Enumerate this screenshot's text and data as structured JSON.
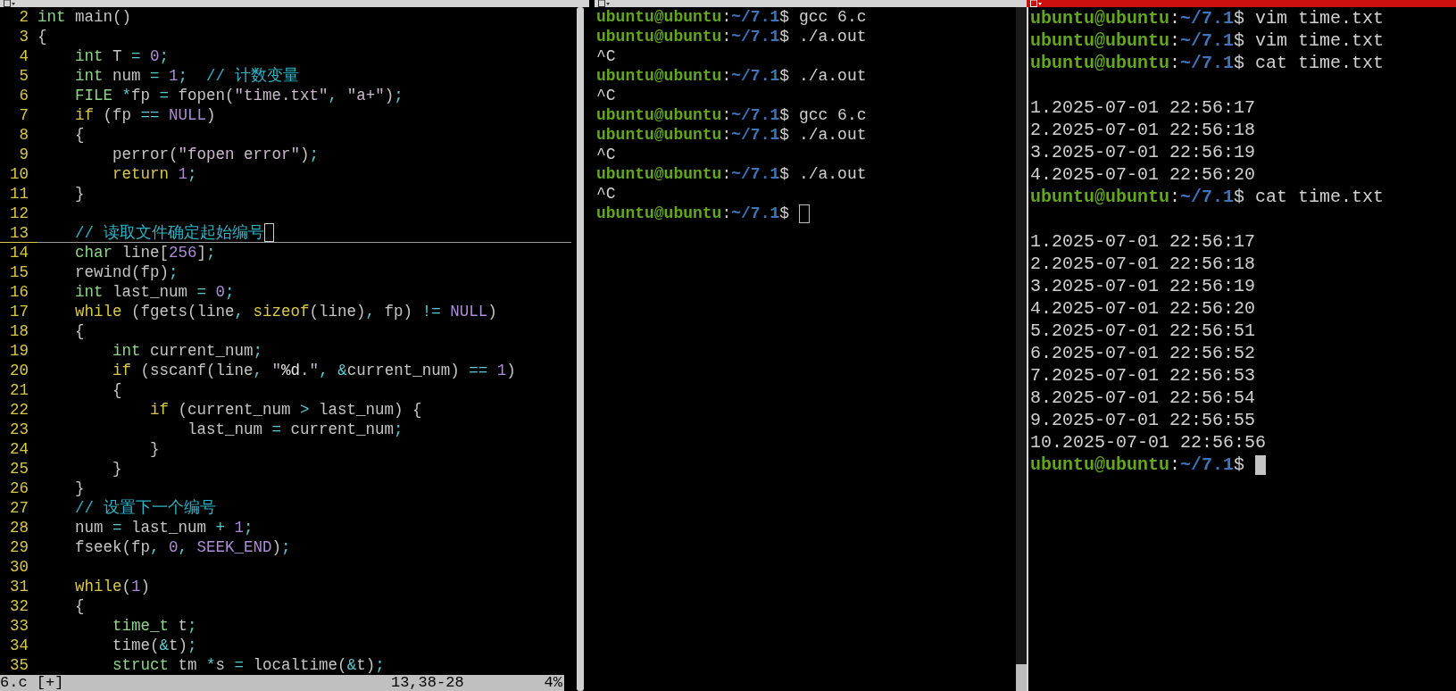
{
  "panes": [
    {
      "kind": "vim",
      "active": false,
      "lines": [
        {
          "number": "2",
          "segments": [
            {
              "kind": "type",
              "text": "int"
            },
            {
              "kind": "plain",
              "text": " main()"
            }
          ]
        },
        {
          "number": "3",
          "segments": [
            {
              "kind": "plain",
              "text": "{"
            }
          ]
        },
        {
          "number": "4",
          "segments": [
            {
              "kind": "type",
              "text": "    int"
            },
            {
              "kind": "plain",
              "text": " T "
            },
            {
              "kind": "op",
              "text": "="
            },
            {
              "kind": "num",
              "text": " 0"
            },
            {
              "kind": "op",
              "text": ";"
            }
          ]
        },
        {
          "number": "5",
          "segments": [
            {
              "kind": "type",
              "text": "    int"
            },
            {
              "kind": "plain",
              "text": " num "
            },
            {
              "kind": "op",
              "text": "="
            },
            {
              "kind": "num",
              "text": " 1"
            },
            {
              "kind": "op",
              "text": ";"
            },
            {
              "kind": "comment",
              "text": "  // 计数变量"
            }
          ]
        },
        {
          "number": "6",
          "segments": [
            {
              "kind": "type",
              "text": "    FILE"
            },
            {
              "kind": "op",
              "text": " *"
            },
            {
              "kind": "plain",
              "text": "fp "
            },
            {
              "kind": "op",
              "text": "="
            },
            {
              "kind": "plain",
              "text": " fopen("
            },
            {
              "kind": "str",
              "text": "\"time.txt\""
            },
            {
              "kind": "op",
              "text": ","
            },
            {
              "kind": "str",
              "text": " \"a+\""
            },
            {
              "kind": "plain",
              "text": ")"
            },
            {
              "kind": "op",
              "text": ";"
            }
          ]
        },
        {
          "number": "7",
          "segments": [
            {
              "kind": "kw",
              "text": "    if"
            },
            {
              "kind": "plain",
              "text": " (fp "
            },
            {
              "kind": "op",
              "text": "=="
            },
            {
              "kind": "num",
              "text": " NULL"
            },
            {
              "kind": "plain",
              "text": ")"
            }
          ]
        },
        {
          "number": "8",
          "segments": [
            {
              "kind": "plain",
              "text": "    {"
            }
          ]
        },
        {
          "number": "9",
          "segments": [
            {
              "kind": "plain",
              "text": "        perror("
            },
            {
              "kind": "str",
              "text": "\"fopen error\""
            },
            {
              "kind": "plain",
              "text": ")"
            },
            {
              "kind": "op",
              "text": ";"
            }
          ]
        },
        {
          "number": "10",
          "segments": [
            {
              "kind": "kw",
              "text": "        return"
            },
            {
              "kind": "num",
              "text": " 1"
            },
            {
              "kind": "op",
              "text": ";"
            }
          ]
        },
        {
          "number": "11",
          "segments": [
            {
              "kind": "plain",
              "text": "    }"
            }
          ]
        },
        {
          "number": "12"
        },
        {
          "number": "13",
          "cursor_line": true,
          "cursor": true,
          "segments": [
            {
              "kind": "comment",
              "text": "    // 读取文件确定起始编号"
            }
          ]
        },
        {
          "number": "14",
          "segments": [
            {
              "kind": "type",
              "text": "    char"
            },
            {
              "kind": "plain",
              "text": " line["
            },
            {
              "kind": "num",
              "text": "256"
            },
            {
              "kind": "plain",
              "text": "]"
            },
            {
              "kind": "op",
              "text": ";"
            }
          ]
        },
        {
          "number": "15",
          "segments": [
            {
              "kind": "plain",
              "text": "    rewind(fp)"
            },
            {
              "kind": "op",
              "text": ";"
            }
          ]
        },
        {
          "number": "16",
          "segments": [
            {
              "kind": "type",
              "text": "    int"
            },
            {
              "kind": "plain",
              "text": " last_num "
            },
            {
              "kind": "op",
              "text": "="
            },
            {
              "kind": "num",
              "text": " 0"
            },
            {
              "kind": "op",
              "text": ";"
            }
          ]
        },
        {
          "number": "17",
          "segments": [
            {
              "kind": "kw",
              "text": "    while"
            },
            {
              "kind": "plain",
              "text": " (fgets(line"
            },
            {
              "kind": "op",
              "text": ","
            },
            {
              "kind": "kw",
              "text": " sizeof"
            },
            {
              "kind": "plain",
              "text": "(line)"
            },
            {
              "kind": "op",
              "text": ","
            },
            {
              "kind": "plain",
              "text": " fp) "
            },
            {
              "kind": "op",
              "text": "!="
            },
            {
              "kind": "num",
              "text": " NULL"
            },
            {
              "kind": "plain",
              "text": ")"
            }
          ]
        },
        {
          "number": "18",
          "segments": [
            {
              "kind": "plain",
              "text": "    {"
            }
          ]
        },
        {
          "number": "19",
          "segments": [
            {
              "kind": "type",
              "text": "        int"
            },
            {
              "kind": "plain",
              "text": " current_num"
            },
            {
              "kind": "op",
              "text": ";"
            }
          ]
        },
        {
          "number": "20",
          "segments": [
            {
              "kind": "kw",
              "text": "        if"
            },
            {
              "kind": "plain",
              "text": " (sscanf(line"
            },
            {
              "kind": "op",
              "text": ","
            },
            {
              "kind": "str",
              "text": " \""
            },
            {
              "kind": "fmt",
              "text": "%d"
            },
            {
              "kind": "str",
              "text": ".\""
            },
            {
              "kind": "op",
              "text": ","
            },
            {
              "kind": "op",
              "text": " &"
            },
            {
              "kind": "plain",
              "text": "current_num) "
            },
            {
              "kind": "op",
              "text": "=="
            },
            {
              "kind": "num",
              "text": " 1"
            },
            {
              "kind": "plain",
              "text": ")"
            }
          ]
        },
        {
          "number": "21",
          "segments": [
            {
              "kind": "plain",
              "text": "        {"
            }
          ]
        },
        {
          "number": "22",
          "segments": [
            {
              "kind": "kw",
              "text": "            if"
            },
            {
              "kind": "plain",
              "text": " (current_num "
            },
            {
              "kind": "op",
              "text": ">"
            },
            {
              "kind": "plain",
              "text": " last_num) {"
            }
          ]
        },
        {
          "number": "23",
          "segments": [
            {
              "kind": "plain",
              "text": "                last_num "
            },
            {
              "kind": "op",
              "text": "="
            },
            {
              "kind": "plain",
              "text": " current_num"
            },
            {
              "kind": "op",
              "text": ";"
            }
          ]
        },
        {
          "number": "24",
          "segments": [
            {
              "kind": "plain",
              "text": "            }"
            }
          ]
        },
        {
          "number": "25",
          "segments": [
            {
              "kind": "plain",
              "text": "        }"
            }
          ]
        },
        {
          "number": "26",
          "segments": [
            {
              "kind": "plain",
              "text": "    }"
            }
          ]
        },
        {
          "number": "27",
          "segments": [
            {
              "kind": "comment",
              "text": "    // 设置下一个编号"
            }
          ]
        },
        {
          "number": "28",
          "segments": [
            {
              "kind": "plain",
              "text": "    num "
            },
            {
              "kind": "op",
              "text": "="
            },
            {
              "kind": "plain",
              "text": " last_num "
            },
            {
              "kind": "op",
              "text": "+"
            },
            {
              "kind": "num",
              "text": " 1"
            },
            {
              "kind": "op",
              "text": ";"
            }
          ]
        },
        {
          "number": "29",
          "segments": [
            {
              "kind": "plain",
              "text": "    fseek(fp"
            },
            {
              "kind": "op",
              "text": ","
            },
            {
              "kind": "num",
              "text": " 0"
            },
            {
              "kind": "op",
              "text": ","
            },
            {
              "kind": "num",
              "text": " SEEK_END"
            },
            {
              "kind": "plain",
              "text": ")"
            },
            {
              "kind": "op",
              "text": ";"
            }
          ]
        },
        {
          "number": "30"
        },
        {
          "number": "31",
          "segments": [
            {
              "kind": "kw",
              "text": "    while"
            },
            {
              "kind": "plain",
              "text": "("
            },
            {
              "kind": "num",
              "text": "1"
            },
            {
              "kind": "plain",
              "text": ")"
            }
          ]
        },
        {
          "number": "32",
          "segments": [
            {
              "kind": "plain",
              "text": "    {"
            }
          ]
        },
        {
          "number": "33",
          "segments": [
            {
              "kind": "type",
              "text": "        time_t"
            },
            {
              "kind": "plain",
              "text": " t"
            },
            {
              "kind": "op",
              "text": ";"
            }
          ]
        },
        {
          "number": "34",
          "segments": [
            {
              "kind": "plain",
              "text": "        time("
            },
            {
              "kind": "op",
              "text": "&"
            },
            {
              "kind": "plain",
              "text": "t)"
            },
            {
              "kind": "op",
              "text": ";"
            }
          ]
        },
        {
          "number": "35",
          "segments": [
            {
              "kind": "type",
              "text": "        struct"
            },
            {
              "kind": "plain",
              "text": " tm "
            },
            {
              "kind": "op",
              "text": "*"
            },
            {
              "kind": "plain",
              "text": "s "
            },
            {
              "kind": "op",
              "text": "="
            },
            {
              "kind": "plain",
              "text": " localtime("
            },
            {
              "kind": "op",
              "text": "&"
            },
            {
              "kind": "plain",
              "text": "t)"
            },
            {
              "kind": "op",
              "text": ";"
            }
          ]
        }
      ],
      "status": {
        "file": "6.c [+]",
        "position": "13,38-28",
        "percent": "4%"
      }
    },
    {
      "kind": "terminal",
      "active": false,
      "lines": [
        {
          "kind": "prompt",
          "user": "ubuntu@ubuntu",
          "sep": ":",
          "path": "~/7.1",
          "sigil": "$",
          "command": "gcc 6.c"
        },
        {
          "kind": "prompt",
          "user": "ubuntu@ubuntu",
          "sep": ":",
          "path": "~/7.1",
          "sigil": "$",
          "command": "./a.out"
        },
        {
          "kind": "output",
          "text": "^C"
        },
        {
          "kind": "prompt",
          "user": "ubuntu@ubuntu",
          "sep": ":",
          "path": "~/7.1",
          "sigil": "$",
          "command": "./a.out"
        },
        {
          "kind": "output",
          "text": "^C"
        },
        {
          "kind": "prompt",
          "user": "ubuntu@ubuntu",
          "sep": ":",
          "path": "~/7.1",
          "sigil": "$",
          "command": "gcc 6.c"
        },
        {
          "kind": "prompt",
          "user": "ubuntu@ubuntu",
          "sep": ":",
          "path": "~/7.1",
          "sigil": "$",
          "command": "./a.out"
        },
        {
          "kind": "output",
          "text": "^C"
        },
        {
          "kind": "prompt",
          "user": "ubuntu@ubuntu",
          "sep": ":",
          "path": "~/7.1",
          "sigil": "$",
          "command": "./a.out"
        },
        {
          "kind": "output",
          "text": "^C"
        },
        {
          "kind": "prompt",
          "user": "ubuntu@ubuntu",
          "sep": ":",
          "path": "~/7.1",
          "sigil": "$",
          "cursor": true,
          "cursor_filled": false
        }
      ]
    },
    {
      "kind": "terminal",
      "active": true,
      "lines": [
        {
          "kind": "prompt",
          "user": "ubuntu@ubuntu",
          "sep": ":",
          "path": "~/7.1",
          "sigil": "$",
          "command": "vim time.txt"
        },
        {
          "kind": "prompt",
          "user": "ubuntu@ubuntu",
          "sep": ":",
          "path": "~/7.1",
          "sigil": "$",
          "command": "vim time.txt"
        },
        {
          "kind": "prompt",
          "user": "ubuntu@ubuntu",
          "sep": ":",
          "path": "~/7.1",
          "sigil": "$",
          "command": "cat time.txt"
        },
        {
          "kind": "blank"
        },
        {
          "kind": "output",
          "text": "1.2025-07-01 22:56:17"
        },
        {
          "kind": "output",
          "text": "2.2025-07-01 22:56:18"
        },
        {
          "kind": "output",
          "text": "3.2025-07-01 22:56:19"
        },
        {
          "kind": "output",
          "text": "4.2025-07-01 22:56:20"
        },
        {
          "kind": "prompt",
          "user": "ubuntu@ubuntu",
          "sep": ":",
          "path": "~/7.1",
          "sigil": "$",
          "command": "cat time.txt"
        },
        {
          "kind": "blank"
        },
        {
          "kind": "output",
          "text": "1.2025-07-01 22:56:17"
        },
        {
          "kind": "output",
          "text": "2.2025-07-01 22:56:18"
        },
        {
          "kind": "output",
          "text": "3.2025-07-01 22:56:19"
        },
        {
          "kind": "output",
          "text": "4.2025-07-01 22:56:20"
        },
        {
          "kind": "output",
          "text": "5.2025-07-01 22:56:51"
        },
        {
          "kind": "output",
          "text": "6.2025-07-01 22:56:52"
        },
        {
          "kind": "output",
          "text": "7.2025-07-01 22:56:53"
        },
        {
          "kind": "output",
          "text": "8.2025-07-01 22:56:54"
        },
        {
          "kind": "output",
          "text": "9.2025-07-01 22:56:55"
        },
        {
          "kind": "output",
          "text": "10.2025-07-01 22:56:56"
        },
        {
          "kind": "prompt",
          "user": "ubuntu@ubuntu",
          "sep": ":",
          "path": "~/7.1",
          "sigil": "$",
          "cursor": true,
          "cursor_filled": true
        }
      ]
    }
  ]
}
